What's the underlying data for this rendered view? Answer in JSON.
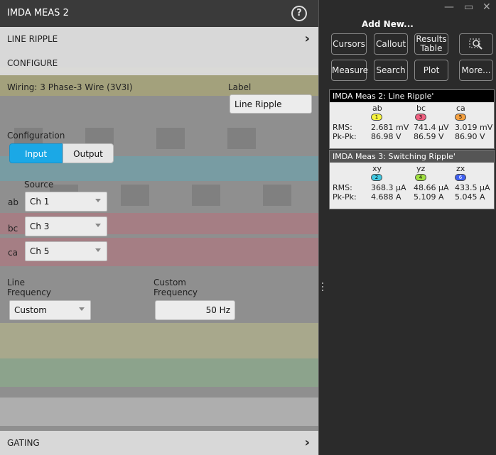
{
  "left_panel": {
    "title": "IMDA MEAS 2",
    "help_icon_glyph": "?",
    "line_ripple_header": "LINE RIPPLE",
    "configure_header": "CONFIGURE",
    "wiring_text": "Wiring: 3 Phase-3 Wire (3V3I)",
    "label_caption": "Label",
    "label_value": "Line Ripple",
    "configuration_caption": "Configuration",
    "config_input": "Input",
    "config_output": "Output",
    "source_caption": "Source",
    "sources": [
      {
        "phase": "ab",
        "channel": "Ch 1"
      },
      {
        "phase": "bc",
        "channel": "Ch 3"
      },
      {
        "phase": "ca",
        "channel": "Ch 5"
      }
    ],
    "line_freq_caption_1": "Line",
    "line_freq_caption_2": "Frequency",
    "line_freq_value": "Custom",
    "custom_freq_caption_1": "Custom",
    "custom_freq_caption_2": "Frequency",
    "custom_freq_value": "50 Hz",
    "gating_header": "GATING",
    "chevron_glyph": "›"
  },
  "right_panel": {
    "add_new_title": "Add New...",
    "buttons": {
      "cursors": "Cursors",
      "callout": "Callout",
      "results_table_1": "Results",
      "results_table_2": "Table",
      "measure": "Measure",
      "search": "Search",
      "plot": "Plot",
      "more": "More..."
    },
    "window_minimize": "—",
    "window_restore": "▭",
    "window_close": "✕",
    "card1": {
      "title": "IMDA Meas 2: Line Ripple'",
      "columns": [
        "ab",
        "bc",
        "ca"
      ],
      "badges": [
        "1",
        "3",
        "5"
      ],
      "badge_colors": [
        "#f7f43e",
        "#f06080",
        "#f4a040"
      ],
      "rows": [
        {
          "label": "RMS:",
          "values": [
            "2.681 mV",
            "741.4 µV",
            "3.019 mV"
          ]
        },
        {
          "label": "Pk-Pk:",
          "values": [
            "86.98 V",
            "86.59 V",
            "86.90 V"
          ]
        }
      ]
    },
    "card2": {
      "title": "IMDA Meas 3: Switching Ripple'",
      "columns": [
        "xy",
        "yz",
        "zx"
      ],
      "badges": [
        "2",
        "4",
        "6"
      ],
      "badge_colors": [
        "#40c8e0",
        "#a0e040",
        "#4060f0"
      ],
      "rows": [
        {
          "label": "RMS:",
          "values": [
            "368.3 µA",
            "48.66 µA",
            "433.5 µA"
          ]
        },
        {
          "label": "Pk-Pk:",
          "values": [
            "4.688 A",
            "5.109 A",
            "5.045 A"
          ]
        }
      ]
    }
  }
}
